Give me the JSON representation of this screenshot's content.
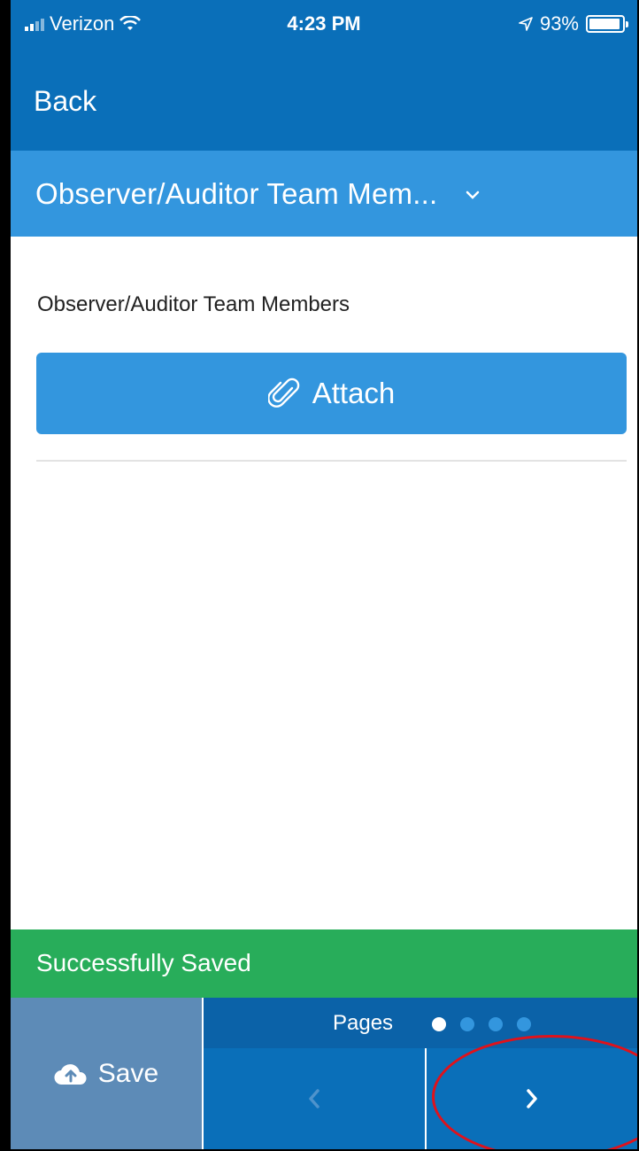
{
  "status_bar": {
    "carrier": "Verizon",
    "time": "4:23 PM",
    "battery_percent": "93%",
    "battery_level": 0.93
  },
  "nav": {
    "back_label": "Back"
  },
  "section": {
    "title": "Observer/Auditor Team Mem...",
    "dropdown_icon": "chevron-down-icon"
  },
  "form": {
    "field_label": "Observer/Auditor Team Members",
    "attach_label": "Attach",
    "attach_icon": "paperclip-icon"
  },
  "banner": {
    "message": "Successfully Saved"
  },
  "footer": {
    "save_label": "Save",
    "save_icon": "cloud-upload-icon",
    "pages_label": "Pages",
    "page_count": 4,
    "current_page": 1
  },
  "colors": {
    "primary": "#0a6fb9",
    "accent": "#3396de",
    "success": "#28ad5a",
    "save_bg": "#5d8bb7",
    "annotation": "#e0121b"
  }
}
